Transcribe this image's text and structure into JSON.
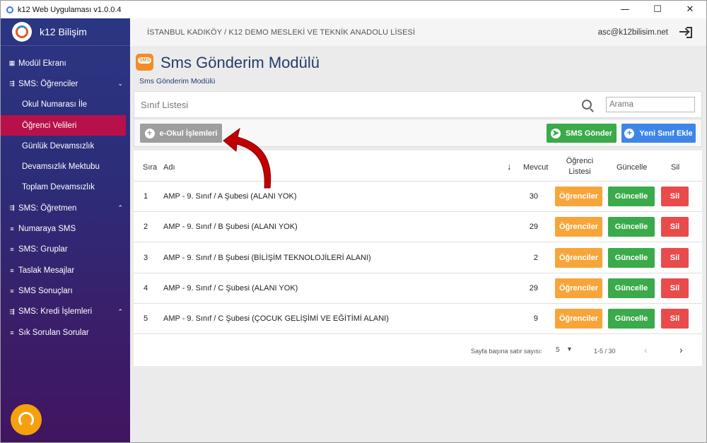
{
  "window": {
    "title": "k12 Web Uygulaması v1.0.0.4",
    "minimize": "—",
    "maximize": "☐",
    "close": "✕"
  },
  "sidebar": {
    "brand": "k12 Bilişim",
    "items": [
      {
        "label": "Modül Ekranı",
        "icon": "▦",
        "level": 0
      },
      {
        "label": "SMS: Öğrenciler",
        "icon": "⇶",
        "level": 0,
        "chevron": "⌄"
      },
      {
        "label": "Okul Numarası İle",
        "level": 1
      },
      {
        "label": "Öğrenci Velileri",
        "level": 1,
        "active": true
      },
      {
        "label": "Günlük Devamsızlık",
        "level": 1
      },
      {
        "label": "Devamsızlık Mektubu",
        "level": 1
      },
      {
        "label": "Toplam Devamsızlık",
        "level": 1
      },
      {
        "label": "SMS: Öğretmen",
        "icon": "⇶",
        "level": 0,
        "chevron": "⌃"
      },
      {
        "label": "Numaraya SMS",
        "icon": "≡",
        "level": 0
      },
      {
        "label": "SMS: Gruplar",
        "icon": "≡",
        "level": 0
      },
      {
        "label": "Taslak Mesajlar",
        "icon": "≡",
        "level": 0
      },
      {
        "label": "SMS Sonuçları",
        "icon": "≡",
        "level": 0
      },
      {
        "label": "SMS: Kredi İşlemleri",
        "icon": "⇶",
        "level": 0,
        "chevron": "⌃"
      },
      {
        "label": "Sık Sorulan Sorular",
        "icon": "≡",
        "level": 0
      }
    ],
    "active_color": "#b8104a"
  },
  "topbar": {
    "school": "İSTANBUL KADIKÖY / K12 DEMO MESLEKİ VE TEKNİK ANADOLU LİSESİ",
    "email": "asc@k12bilisim.net"
  },
  "page": {
    "title": "Sms Gönderim Modülü",
    "breadcrumb": "Sms Gönderim Modülü"
  },
  "list": {
    "title": "Sınıf Listesi",
    "search_placeholder": "Arama"
  },
  "actions": {
    "eokul": "e-Okul İşlemleri",
    "sms_send": "SMS Gönder",
    "new_class": "Yeni Sınıf Ekle"
  },
  "table": {
    "headers": {
      "sira": "Sıra",
      "adi": "Adı",
      "sort_icon": "↓",
      "mevcut": "Mevcut",
      "ogrenci_listesi_1": "Öğrenci",
      "ogrenci_listesi_2": "Listesi",
      "guncelle": "Güncelle",
      "sil": "Sil"
    },
    "rows": [
      {
        "sira": "1",
        "adi": "AMP -  9. Sınıf / A Şubesi (ALANI YOK)",
        "mevcut": "30"
      },
      {
        "sira": "2",
        "adi": "AMP -  9. Sınıf / B Şubesi (ALANI YOK)",
        "mevcut": "29"
      },
      {
        "sira": "3",
        "adi": "AMP -  9. Sınıf / B Şubesi (BİLİŞİM TEKNOLOJİLERİ ALANI)",
        "mevcut": "2"
      },
      {
        "sira": "4",
        "adi": "AMP -  9. Sınıf / C Şubesi (ALANI YOK)",
        "mevcut": "29"
      },
      {
        "sira": "5",
        "adi": "AMP -  9. Sınıf / C Şubesi (ÇOCUK GELİŞİMİ VE EĞİTİMİ ALANI)",
        "mevcut": "9"
      }
    ],
    "row_buttons": {
      "ogrenciler": "Öğrenciler",
      "guncelle": "Güncelle",
      "sil": "Sil"
    }
  },
  "pagination": {
    "rows_per_page_label": "Sayfa başına satır sayısı:",
    "rows_per_page": "5",
    "range": "1-5 / 30"
  },
  "colors": {
    "orange": "#f7a53a",
    "green": "#3aaa4a",
    "red": "#e94b4b",
    "blue": "#3d86e8",
    "grey": "#9e9e9e",
    "annotation_arrow": "#c00000"
  }
}
